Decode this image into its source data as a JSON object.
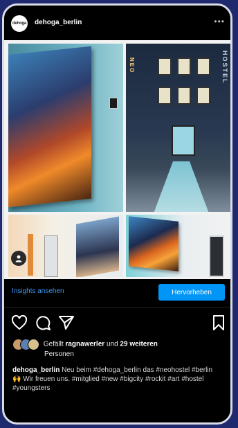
{
  "header": {
    "username": "dehoga_berlin",
    "avatar_text": "dehoga",
    "more_label": "•••"
  },
  "post": {
    "sign_hostel": "HOSTEL",
    "sign_neo": "NEO"
  },
  "insights_row": {
    "insights_label": "Insights ansehen",
    "promote_label": "Hervorheben"
  },
  "likes": {
    "prefix": "Gefällt",
    "user": "ragnawerler",
    "connector": "und",
    "count_text": "29 weiteren",
    "suffix": "Personen"
  },
  "caption": {
    "username": "dehoga_berlin",
    "text": "Neu beim #dehoga_berlin das #neohostel #berlin 🙌 Wir freuen uns. #mitglied #new #bigcity #rockit #art #hostel #youngsters"
  },
  "icons": {
    "like": "heart-icon",
    "comment": "comment-icon",
    "share": "send-icon",
    "save": "bookmark-icon",
    "tag": "person-tag-icon"
  },
  "colors": {
    "frame_background": "#1f2a6e",
    "accent_blue": "#0095f6",
    "link_blue": "#3897f0"
  }
}
